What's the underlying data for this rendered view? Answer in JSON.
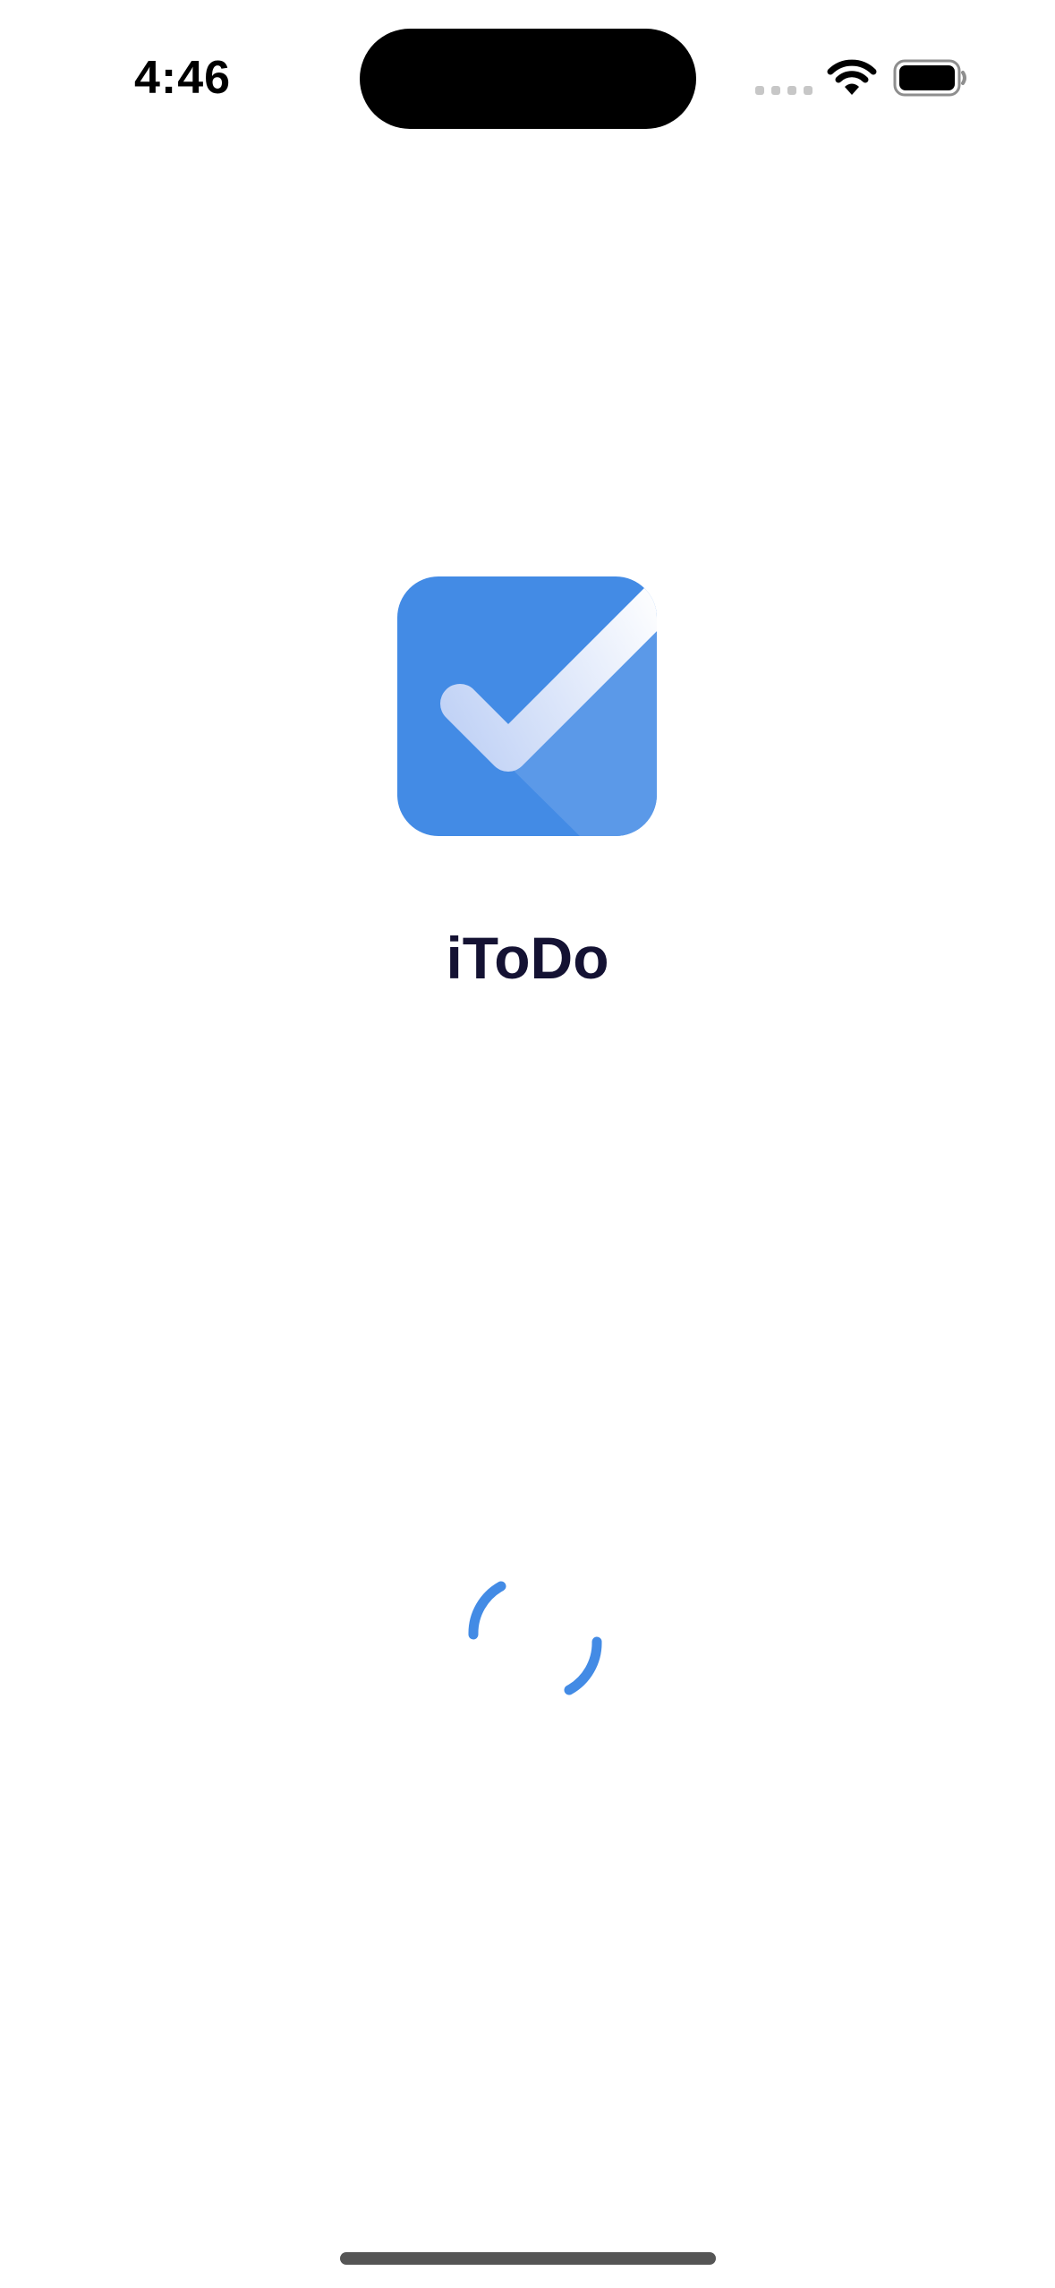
{
  "status_bar": {
    "time": "4:46",
    "signal_icon": "signal-dots-icon",
    "wifi_icon": "wifi-icon",
    "battery_icon": "battery-icon"
  },
  "app": {
    "title": "iToDo",
    "logo_icon": "checkmark-icon",
    "brand_color": "#438BE5",
    "title_color": "#141233"
  },
  "loading": {
    "spinner_icon": "loading-spinner-icon",
    "spinner_color": "#438BE5"
  }
}
